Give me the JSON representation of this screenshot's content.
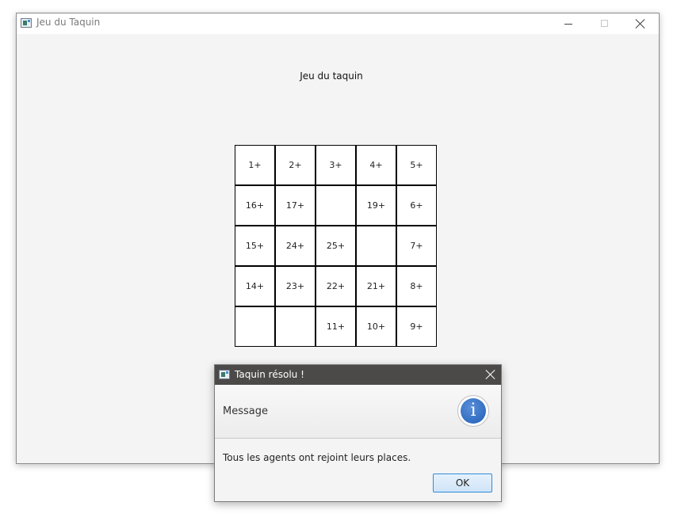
{
  "window": {
    "title": "Jeu du Taquin",
    "icon": "app-icon"
  },
  "main": {
    "heading": "Jeu du taquin",
    "board": [
      [
        "1+",
        "2+",
        "3+",
        "4+",
        "5+"
      ],
      [
        "16+",
        "17+",
        "",
        "19+",
        "6+"
      ],
      [
        "15+",
        "24+",
        "25+",
        "",
        "7+"
      ],
      [
        "14+",
        "23+",
        "22+",
        "21+",
        "8+"
      ],
      [
        "",
        "",
        "11+",
        "10+",
        "9+"
      ]
    ]
  },
  "dialog": {
    "title": "Taquin résolu !",
    "header": "Message",
    "content": "Tous les agents ont rejoint leurs places.",
    "ok_label": "OK",
    "info_glyph": "i",
    "icon": "info-icon"
  },
  "colors": {
    "dialog_titlebar": "#4c4a48",
    "info_blue": "#1f5fb8",
    "ok_border": "#2e8ed8"
  }
}
